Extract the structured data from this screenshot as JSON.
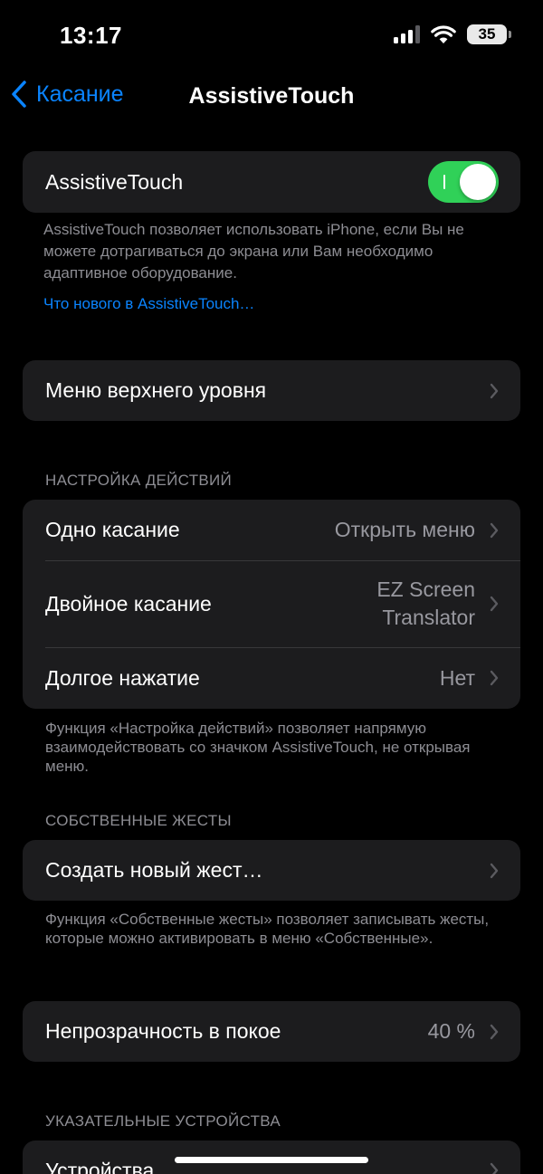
{
  "status_bar": {
    "time": "13:17",
    "battery_level": "35"
  },
  "nav": {
    "back_label": "Касание",
    "title": "AssistiveTouch"
  },
  "main_toggle": {
    "label": "AssistiveTouch",
    "state": "on",
    "description": "AssistiveTouch позволяет использовать iPhone, если Вы не можете дотрагиваться до экрана или Вам необходимо адаптивное оборудование.",
    "link": "Что нового в AssistiveTouch…"
  },
  "top_menu": {
    "label": "Меню верхнего уровня"
  },
  "custom_actions": {
    "header": "НАСТРОЙКА ДЕЙСТВИЙ",
    "rows": [
      {
        "label": "Одно касание",
        "value": "Открыть меню"
      },
      {
        "label": "Двойное касание",
        "value_line1": "EZ Screen",
        "value_line2": "Translator"
      },
      {
        "label": "Долгое нажатие",
        "value": "Нет"
      }
    ],
    "footer": "Функция «Настройка действий» позволяет напрямую взаимодействовать со значком AssistiveTouch, не открывая меню."
  },
  "custom_gestures": {
    "header": "СОБСТВЕННЫЕ ЖЕСТЫ",
    "row_label": "Создать новый жест…",
    "footer": "Функция «Собственные жесты» позволяет записывать жесты, которые можно активировать в меню «Собственные»."
  },
  "idle_opacity": {
    "label": "Непрозрачность в покое",
    "value": "40 %"
  },
  "pointer_devices": {
    "header": "УКАЗАТЕЛЬНЫЕ УСТРОЙСТВА",
    "row_label": "Устройства"
  },
  "colors": {
    "background": "#000000",
    "cell": "#1c1c1e",
    "accent": "#0a84ff",
    "toggle_on": "#30d158",
    "secondary_text": "#8d8d93"
  }
}
